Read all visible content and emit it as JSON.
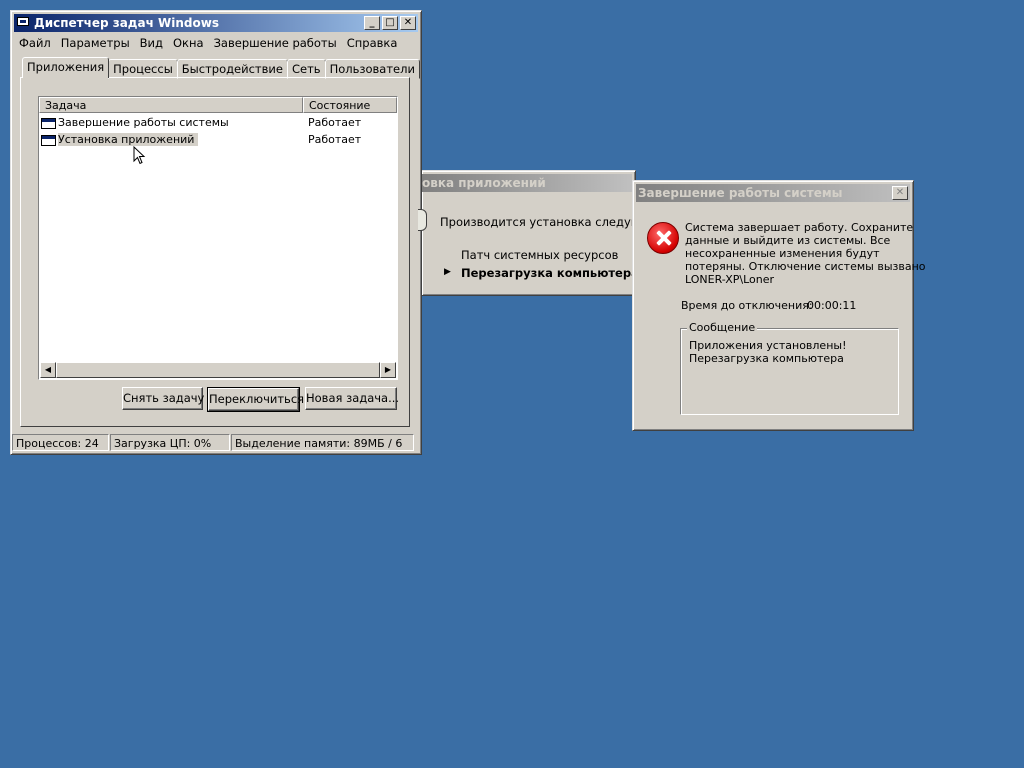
{
  "task_manager": {
    "title": "Диспетчер задач Windows",
    "menu": [
      "Файл",
      "Параметры",
      "Вид",
      "Окна",
      "Завершение работы",
      "Справка"
    ],
    "tabs": [
      "Приложения",
      "Процессы",
      "Быстродействие",
      "Сеть",
      "Пользователи"
    ],
    "selected_tab": "Приложения",
    "columns": [
      "Задача",
      "Состояние"
    ],
    "rows": [
      {
        "task": "Завершение работы системы",
        "status": "Работает"
      },
      {
        "task": "Установка приложений",
        "status": "Работает"
      }
    ],
    "buttons": {
      "end_task": "Снять задачу",
      "switch_to": "Переключиться",
      "new_task": "Новая задача..."
    },
    "status": {
      "processes": "Процессов: 24",
      "cpu": "Загрузка ЦП: 0%",
      "memory": "Выделение памяти: 89МБ / 6"
    }
  },
  "installer": {
    "title": "овка приложений",
    "intro": "Производится установка следующих з",
    "items": [
      "Патч системных ресурсов",
      "Перезагрузка компьютера"
    ],
    "current_item": "Перезагрузка компьютера"
  },
  "shutdown": {
    "title": "Завершение работы системы",
    "message_lines": [
      "Система завершает работу.  Сохраните",
      "данные и выйдите из системы.  Все",
      "несохраненные изменения будут",
      "потеряны.  Отключение системы вызвано",
      "LONER-XP\\Loner"
    ],
    "time_label": "Время до отключения:",
    "time_value": "00:00:11",
    "message_group": "Сообщение",
    "message_text_lines": [
      "Приложения установлены!",
      "Перезагрузка компьютера"
    ]
  },
  "colors": {
    "desktop": "#3a6ea5",
    "active_title": "#0a246a",
    "inactive_title": "#808080",
    "face": "#d4d0c8"
  }
}
